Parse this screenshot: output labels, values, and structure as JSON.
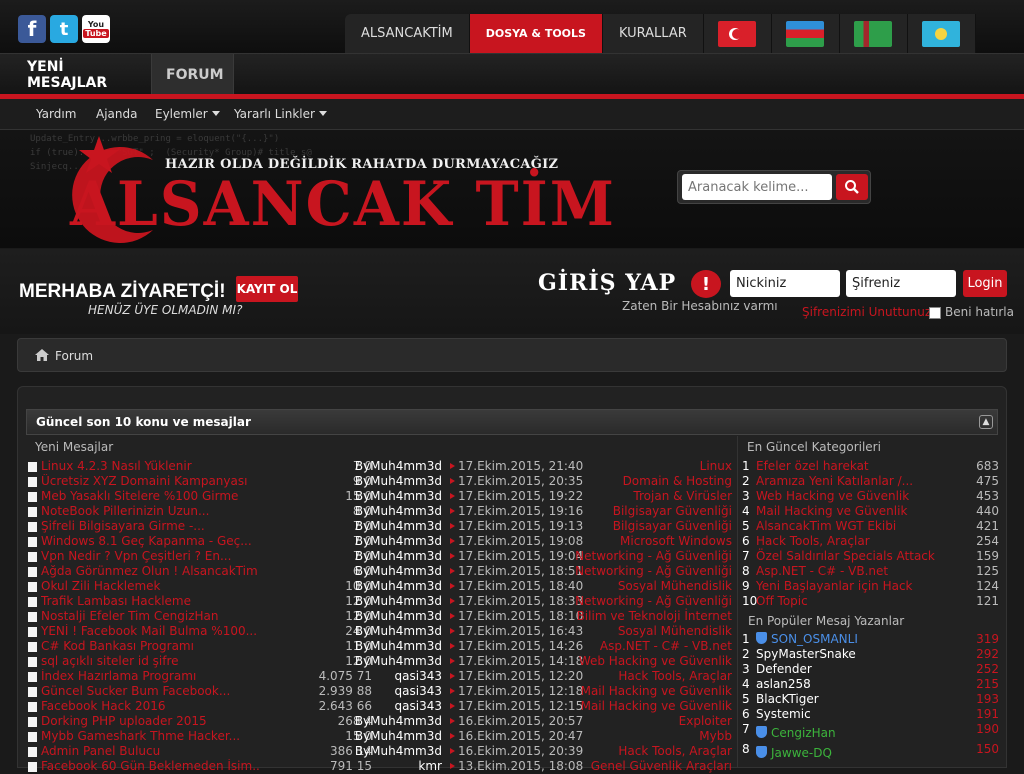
{
  "social": {
    "facebook": "f",
    "twitter": "t",
    "youtube_line1": "You",
    "youtube_line2": "Tube"
  },
  "nav": {
    "items": [
      "ALSANCAKTİM",
      "DOSYA & TOOLS",
      "KURALLAR"
    ],
    "active_index": 1
  },
  "flags": [
    "tr-flag",
    "az-flag",
    "tm-flag",
    "kz-flag"
  ],
  "subtabs": {
    "new_posts": "YENİ MESAJLAR",
    "forum": "FORUM"
  },
  "links": {
    "help": "Yardım",
    "calendar": "Ajanda",
    "actions": "Eylemler",
    "useful": "Yararlı Linkler"
  },
  "banner": {
    "slogan": "HAZIR OLDA DEĞİLDİK RAHATDA DURMAYACAĞIZ",
    "logo": "ALSANCAK TİM",
    "code_lines": [
      "Update_Entry...wrbbe_pring = eloquent(\"{...}\")",
      "if (true)... ec \"SGT\" ;  (Security* Group)# title s@",
      "Sinjecq..."
    ]
  },
  "search": {
    "placeholder": "Aranacak kelime..."
  },
  "login": {
    "hello": "MERHABA ZİYARETÇİ!",
    "register": "KAYIT OL",
    "not_member": "HENÜZ ÜYE OLMADIN MI?",
    "title": "GİRİŞ YAP",
    "has_account": "Zaten Bir Hesabınız varmı",
    "username_placeholder": "Nickiniz",
    "password_placeholder": "Şifreniz",
    "login_button": "Login",
    "forgot": "Şifrenizimi Unuttunuz?",
    "remember": "Beni hatırla"
  },
  "breadcrumb": {
    "home": "Forum"
  },
  "panel": {
    "title": "Güncel son 10 konu ve mesajlar",
    "col_new": "Yeni Mesajlar",
    "col_categories": "En Güncel Kategorileri",
    "col_popular": "En Popüler Mesaj Yazanlar"
  },
  "topics": [
    {
      "title": "Linux 4.2.3 Nasıl Yüklenir",
      "stats": "7 0",
      "user": "ByMuh4mm3d",
      "date": "17.Ekim.2015, 21:40",
      "cat": "Linux"
    },
    {
      "title": "Ücretsiz XYZ Domaini Kampanyası",
      "stats": "9 0",
      "user": "ByMuh4mm3d",
      "date": "17.Ekim.2015, 20:35",
      "cat": "Domain & Hosting"
    },
    {
      "title": "Meb Yasaklı Sitelere %100 Girme",
      "stats": "15 0",
      "user": "ByMuh4mm3d",
      "date": "17.Ekim.2015, 19:22",
      "cat": "Trojan & Virüsler"
    },
    {
      "title": "NoteBook Pillerinizin Uzun...",
      "stats": "8 0",
      "user": "ByMuh4mm3d",
      "date": "17.Ekim.2015, 19:16",
      "cat": "Bilgisayar Güvenliği"
    },
    {
      "title": "Şifreli Bilgisayara Girme -...",
      "stats": "7 0",
      "user": "ByMuh4mm3d",
      "date": "17.Ekim.2015, 19:13",
      "cat": "Bilgisayar Güvenliği"
    },
    {
      "title": "Windows 8.1 Geç Kapanma - Geç...",
      "stats": "7 0",
      "user": "ByMuh4mm3d",
      "date": "17.Ekim.2015, 19:08",
      "cat": "Microsoft Windows"
    },
    {
      "title": "Vpn Nedir ? Vpn Çeşitleri ? En...",
      "stats": "7 0",
      "user": "ByMuh4mm3d",
      "date": "17.Ekim.2015, 19:04",
      "cat": "Networking - Ağ Güvenliği"
    },
    {
      "title": "Ağda Görünmez Olun ! AlsancakTim",
      "stats": "6 0",
      "user": "ByMuh4mm3d",
      "date": "17.Ekim.2015, 18:51",
      "cat": "Networking - Ağ Güvenliği"
    },
    {
      "title": "Okul Zili Hacklemek",
      "stats": "10 0",
      "user": "ByMuh4mm3d",
      "date": "17.Ekim.2015, 18:40",
      "cat": "Sosyal Mühendislik"
    },
    {
      "title": "Trafik Lambası Hackleme",
      "stats": "12 0",
      "user": "ByMuh4mm3d",
      "date": "17.Ekim.2015, 18:33",
      "cat": "Networking - Ağ Güvenliği"
    },
    {
      "title": "Nostalji Efeler Tim CengizHan",
      "stats": "12 0",
      "user": "ByMuh4mm3d",
      "date": "17.Ekim.2015, 18:10",
      "cat": "Bilim ve Teknoloji İnternet"
    },
    {
      "title": "YENİ ! Facebook Mail Bulma %100...",
      "stats": "24 0",
      "user": "ByMuh4mm3d",
      "date": "17.Ekim.2015, 16:43",
      "cat": "Sosyal Mühendislik"
    },
    {
      "title": "C# Kod Bankası Programı",
      "stats": "11 0",
      "user": "ByMuh4mm3d",
      "date": "17.Ekim.2015, 14:26",
      "cat": "Asp.NET - C# - VB.net"
    },
    {
      "title": "sql açıklı siteler id şifre",
      "stats": "12 0",
      "user": "ByMuh4mm3d",
      "date": "17.Ekim.2015, 14:18",
      "cat": "Web Hacking ve Güvenlik"
    },
    {
      "title": "İndex Hazırlama Programı",
      "stats": "4.075 71",
      "user": "qasi343",
      "date": "17.Ekim.2015, 12:20",
      "cat": "Hack Tools, Araçlar"
    },
    {
      "title": "Güncel Sucker Bum Facebook...",
      "stats": "2.939 88",
      "user": "qasi343",
      "date": "17.Ekim.2015, 12:18",
      "cat": "Mail Hacking ve Güvenlik"
    },
    {
      "title": "Facebook Hack 2016",
      "stats": "2.643 66",
      "user": "qasi343",
      "date": "17.Ekim.2015, 12:15",
      "cat": "Mail Hacking ve Güvenlik"
    },
    {
      "title": "Dorking PHP uploader 2015",
      "stats": "268 4",
      "user": "ByMuh4mm3d",
      "date": "16.Ekim.2015, 20:57",
      "cat": "Exploiter"
    },
    {
      "title": "Mybb Gameshark Thme Hacker...",
      "stats": "15 0",
      "user": "ByMuh4mm3d",
      "date": "16.Ekim.2015, 20:47",
      "cat": "Mybb"
    },
    {
      "title": "Admin Panel Bulucu",
      "stats": "386 14",
      "user": "ByMuh4mm3d",
      "date": "16.Ekim.2015, 20:39",
      "cat": "Hack Tools, Araçlar"
    },
    {
      "title": "Facebook 60 Gün Beklemeden İsim...",
      "stats": "791 15",
      "user": "kmr",
      "date": "13.Ekim.2015, 18:08",
      "cat": "Genel Güvenlik Araçları"
    }
  ],
  "categories": [
    {
      "n": "1",
      "name": "Efeler özel harekat",
      "count": "683"
    },
    {
      "n": "2",
      "name": "Aramıza Yeni Katılanlar /...",
      "count": "475"
    },
    {
      "n": "3",
      "name": "Web Hacking ve Güvenlik",
      "count": "453"
    },
    {
      "n": "4",
      "name": "Mail Hacking ve Güvenlik",
      "count": "440"
    },
    {
      "n": "5",
      "name": "AlsancakTim WGT Ekibi",
      "count": "421"
    },
    {
      "n": "6",
      "name": "Hack Tools, Araçlar",
      "count": "254"
    },
    {
      "n": "7",
      "name": "Özel Saldırılar Specials Attack",
      "count": "159"
    },
    {
      "n": "8",
      "name": "Asp.NET - C# - VB.net",
      "count": "125"
    },
    {
      "n": "9",
      "name": "Yeni Başlayanlar için Hack",
      "count": "124"
    },
    {
      "n": "10",
      "name": "Off Topic",
      "count": "121"
    }
  ],
  "posters": [
    {
      "n": "1",
      "name": "SON_OSMANLI",
      "count": "319",
      "color": "#4a8fe8",
      "badge": true
    },
    {
      "n": "2",
      "name": "SpyMasterSnake",
      "count": "292",
      "color": "#ffffff",
      "badge": false
    },
    {
      "n": "3",
      "name": "Defender",
      "count": "252",
      "color": "#ffffff",
      "badge": false
    },
    {
      "n": "4",
      "name": "aslan258",
      "count": "215",
      "color": "#ffffff",
      "badge": false
    },
    {
      "n": "5",
      "name": "BlacKTiger",
      "count": "193",
      "color": "#ffffff",
      "badge": false
    },
    {
      "n": "6",
      "name": "Systemic",
      "count": "191",
      "color": "#ffffff",
      "badge": false
    },
    {
      "n": "7",
      "name": "CengizHan",
      "count": "190",
      "color": "#3cb43c",
      "badge": true
    },
    {
      "n": "8",
      "name": "Jawwe-DQ",
      "count": "150",
      "color": "#3cb43c",
      "badge": true
    }
  ],
  "colors": {
    "accent": "#c8151f",
    "background": "#1a1a1a"
  }
}
